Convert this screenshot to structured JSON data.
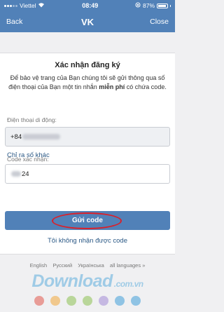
{
  "status_bar": {
    "carrier": "Viettel",
    "time": "08:49",
    "battery": "87%"
  },
  "nav": {
    "back": "Back",
    "title": "VK",
    "close": "Close"
  },
  "form": {
    "title": "Xác nhận đăng ký",
    "description_pre": "Để bảo vệ trang của Bạn chúng tôi sẽ gửi thông qua số điện thoại của Bạn một tin nhắn ",
    "description_bold": "miễn phí",
    "description_post": " có chứa code.",
    "phone_label": "Điện thoại di động:",
    "phone_prefix": "+84",
    "change_number": "Chỉ ra số khác",
    "code_label": "Code xác nhận:",
    "code_suffix": "24",
    "submit": "Gửi code",
    "no_code": "Tôi không nhận được code"
  },
  "languages": [
    "English",
    "Русский",
    "Українська",
    "all languages »"
  ],
  "watermark": {
    "text": "Download",
    "suffix": ".com.vn"
  },
  "colors": {
    "brand": "#5181b8",
    "link": "#2a5885",
    "highlight_ring": "#d9202a",
    "watermark_dots": [
      "#e2574c",
      "#f3a73b",
      "#8cc152",
      "#8cc152",
      "#a38bd6",
      "#3f9fd8",
      "#3f9fd8"
    ]
  }
}
